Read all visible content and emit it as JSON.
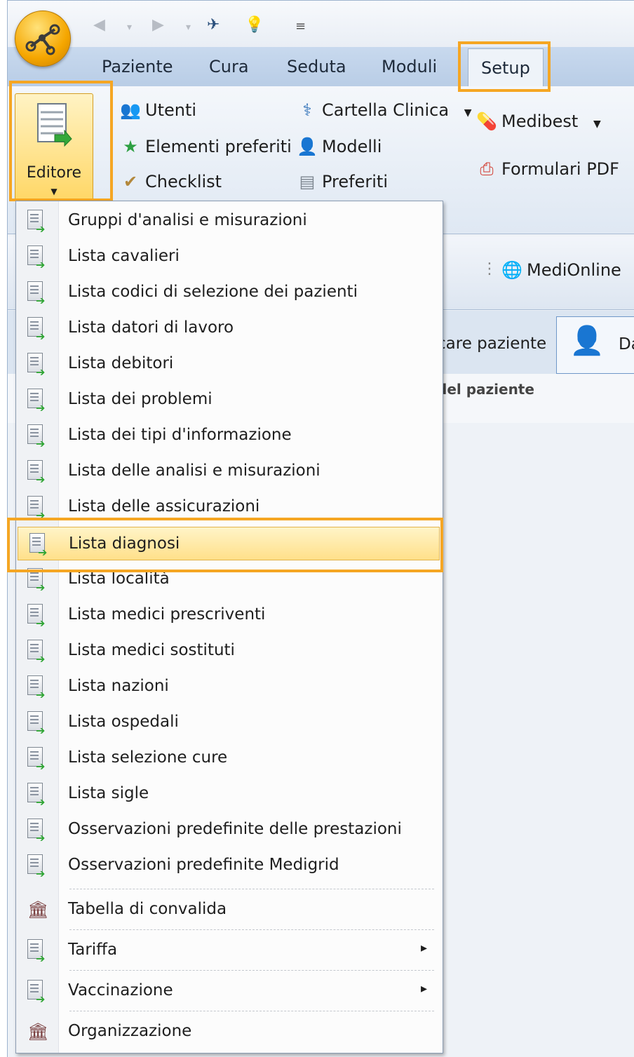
{
  "ribbon_tabs": [
    {
      "label": "Paziente"
    },
    {
      "label": "Cura"
    },
    {
      "label": "Seduta"
    },
    {
      "label": "Moduli"
    },
    {
      "label": "Setup",
      "active": true
    }
  ],
  "ribbon": {
    "editore_label": "Editore",
    "col1": [
      {
        "label": "Utenti",
        "icon": "users-icon"
      },
      {
        "label": "Elementi preferiti",
        "icon": "star-icon"
      },
      {
        "label": "Checklist",
        "icon": "checklist-icon"
      }
    ],
    "col2": [
      {
        "label": "Cartella Clinica",
        "icon": "medical-record-icon"
      },
      {
        "label": "Modelli",
        "icon": "person-icon"
      },
      {
        "label": "Preferiti",
        "icon": "document-icon"
      }
    ],
    "col3": [
      {
        "label": "Medibest",
        "icon": "pill-icon"
      },
      {
        "label": "Formulari PDF",
        "icon": "pdf-icon"
      }
    ]
  },
  "background": {
    "medionline_label": "MediOnline",
    "tab_partial": "care paziente",
    "tab_partial2": "Da",
    "section_partial": "del paziente"
  },
  "menu": {
    "items": [
      {
        "label": "Gruppi d'analisi e misurazioni"
      },
      {
        "label": "Lista cavalieri"
      },
      {
        "label": "Lista codici di selezione dei pazienti"
      },
      {
        "label": "Lista datori di lavoro"
      },
      {
        "label": "Lista debitori"
      },
      {
        "label": "Lista dei problemi"
      },
      {
        "label": "Lista dei tipi d'informazione"
      },
      {
        "label": "Lista delle analisi e misurazioni"
      },
      {
        "label": "Lista delle assicurazioni"
      },
      {
        "label": "Lista diagnosi",
        "selected": true
      },
      {
        "label": "Lista località"
      },
      {
        "label": "Lista medici prescriventi"
      },
      {
        "label": "Lista medici sostituti"
      },
      {
        "label": "Lista nazioni"
      },
      {
        "label": "Lista ospedali"
      },
      {
        "label": "Lista selezione cure"
      },
      {
        "label": "Lista sigle"
      },
      {
        "label": "Osservazioni predefinite delle prestazioni"
      },
      {
        "label": "Osservazioni predefinite Medigrid"
      }
    ],
    "extra_items": [
      {
        "label": "Tabella di convalida"
      },
      {
        "label": "Tariffa"
      },
      {
        "label": "Vaccinazione"
      },
      {
        "label": "Organizzazione"
      }
    ]
  },
  "colors": {
    "highlight": "#f5a623",
    "ribbon": "#c8d9ee",
    "selected_item": "#ffe08a"
  }
}
